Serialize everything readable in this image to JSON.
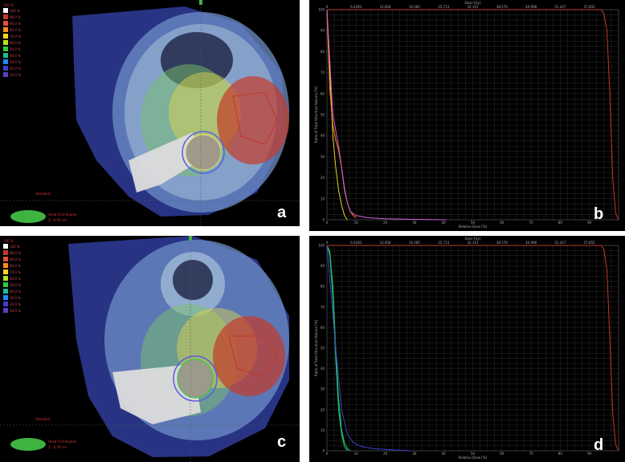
{
  "panels": {
    "a": {
      "letter": "a"
    },
    "b": {
      "letter": "b"
    },
    "c": {
      "letter": "c"
    },
    "d": {
      "letter": "d"
    }
  },
  "colorbar": {
    "top_label": "100 %",
    "items": [
      {
        "label": "100 %",
        "color": "#ffffff"
      },
      {
        "label": "98.0 %",
        "color": "#c0392b"
      },
      {
        "label": "90.0 %",
        "color": "#e74c3c"
      },
      {
        "label": "80.0 %",
        "color": "#ff8c1a"
      },
      {
        "label": "70.0 %",
        "color": "#ffd21a"
      },
      {
        "label": "60.0 %",
        "color": "#b8e01a"
      },
      {
        "label": "50.0 %",
        "color": "#2ecc40"
      },
      {
        "label": "40.0 %",
        "color": "#1abc9c"
      },
      {
        "label": "30.0 %",
        "color": "#1a8cff"
      },
      {
        "label": "20.0 %",
        "color": "#3f3fcf"
      },
      {
        "label": "10.0 %",
        "color": "#5a3fbf"
      }
    ]
  },
  "ct_notes": {
    "a_orientation": "Standard",
    "a_plane": "Head First-Supine",
    "a_z": "Z: -0.95 cm",
    "c_orientation": "Standard",
    "c_plane": "Head First-Supine",
    "c_z": "Z: -0.79 cm"
  },
  "colors": {
    "background": "#000000",
    "grid": "#2a2a2a",
    "ptv_curve": "#c0392b",
    "organ_curve_b_1": "#e6d21a",
    "organ_curve_b_2": "#d35bd3",
    "organ_curve_b_3": "#ff8c1a",
    "organ_curve_d_1": "#2ecc40",
    "organ_curve_d_2": "#1abc9c",
    "organ_curve_d_3": "#3f3fcf"
  },
  "chart_data": [
    {
      "type": "line",
      "panel": "b",
      "xlabel": "Relative Dose [%]",
      "ylabel": "Ratio of Total Structure Volume [%]",
      "top_axis_label": "Dose [Gy]",
      "x_ticks": [
        "0",
        "10",
        "20",
        "30",
        "40",
        "50",
        "60",
        "70",
        "80",
        "90"
      ],
      "top_ticks": [
        "0",
        "6.4283",
        "12.856",
        "19.285",
        "25.713",
        "32.141",
        "38.570",
        "44.998",
        "51.427",
        "57.855"
      ],
      "y_ticks": [
        "0",
        "10",
        "20",
        "30",
        "40",
        "50",
        "60",
        "70",
        "80",
        "90",
        "100"
      ],
      "xlim": [
        0,
        100
      ],
      "ylim": [
        0,
        100
      ],
      "grid": true,
      "series": [
        {
          "color_key": "ptv_curve",
          "x": [
            0,
            94,
            95,
            96,
            97,
            98,
            99,
            100
          ],
          "y": [
            100,
            100,
            98,
            90,
            60,
            20,
            3,
            0
          ]
        },
        {
          "color_key": "organ_curve_b_1",
          "x": [
            0,
            1,
            2,
            3,
            4,
            5,
            6,
            7
          ],
          "y": [
            100,
            70,
            40,
            25,
            14,
            7,
            2,
            0
          ]
        },
        {
          "color_key": "organ_curve_b_3",
          "x": [
            0,
            1,
            2,
            3,
            4,
            5,
            6,
            7,
            8,
            9,
            10
          ],
          "y": [
            100,
            62,
            45,
            38,
            33,
            25,
            15,
            8,
            4,
            2,
            1
          ]
        },
        {
          "color_key": "organ_curve_b_2",
          "x": [
            0,
            2,
            4,
            5,
            6,
            7,
            8,
            10,
            14,
            20,
            30,
            41
          ],
          "y": [
            100,
            50,
            35,
            25,
            14,
            8,
            4,
            2,
            1,
            0.5,
            0.2,
            0
          ]
        }
      ]
    },
    {
      "type": "line",
      "panel": "d",
      "xlabel": "Relative Dose [%]",
      "ylabel": "Ratio of Total Structure Volume [%]",
      "top_axis_label": "Dose [Gy]",
      "x_ticks": [
        "0",
        "10",
        "20",
        "30",
        "40",
        "50",
        "60",
        "70",
        "80",
        "90"
      ],
      "top_ticks": [
        "0",
        "6.4283",
        "12.856",
        "19.285",
        "25.713",
        "32.141",
        "38.570",
        "44.998",
        "51.427",
        "57.855"
      ],
      "y_ticks": [
        "0",
        "10",
        "20",
        "30",
        "40",
        "50",
        "60",
        "70",
        "80",
        "90",
        "100"
      ],
      "xlim": [
        0,
        100
      ],
      "ylim": [
        0,
        100
      ],
      "grid": true,
      "series": [
        {
          "color_key": "ptv_curve",
          "x": [
            0,
            94,
            95,
            96,
            97,
            98,
            99,
            100
          ],
          "y": [
            100,
            100,
            98,
            88,
            55,
            18,
            3,
            0
          ]
        },
        {
          "color_key": "organ_curve_d_1",
          "x": [
            0,
            1,
            2,
            3,
            4,
            5,
            6,
            7,
            8
          ],
          "y": [
            100,
            97,
            80,
            50,
            25,
            10,
            4,
            1,
            0
          ]
        },
        {
          "color_key": "organ_curve_d_2",
          "x": [
            0,
            1,
            2,
            3,
            4,
            5,
            6,
            7
          ],
          "y": [
            100,
            95,
            75,
            45,
            20,
            8,
            2,
            0
          ]
        },
        {
          "color_key": "organ_curve_d_3",
          "x": [
            0,
            3,
            5,
            7,
            9,
            12,
            16,
            22,
            29
          ],
          "y": [
            100,
            50,
            20,
            8,
            4,
            2,
            1,
            0.5,
            0
          ]
        }
      ]
    }
  ]
}
